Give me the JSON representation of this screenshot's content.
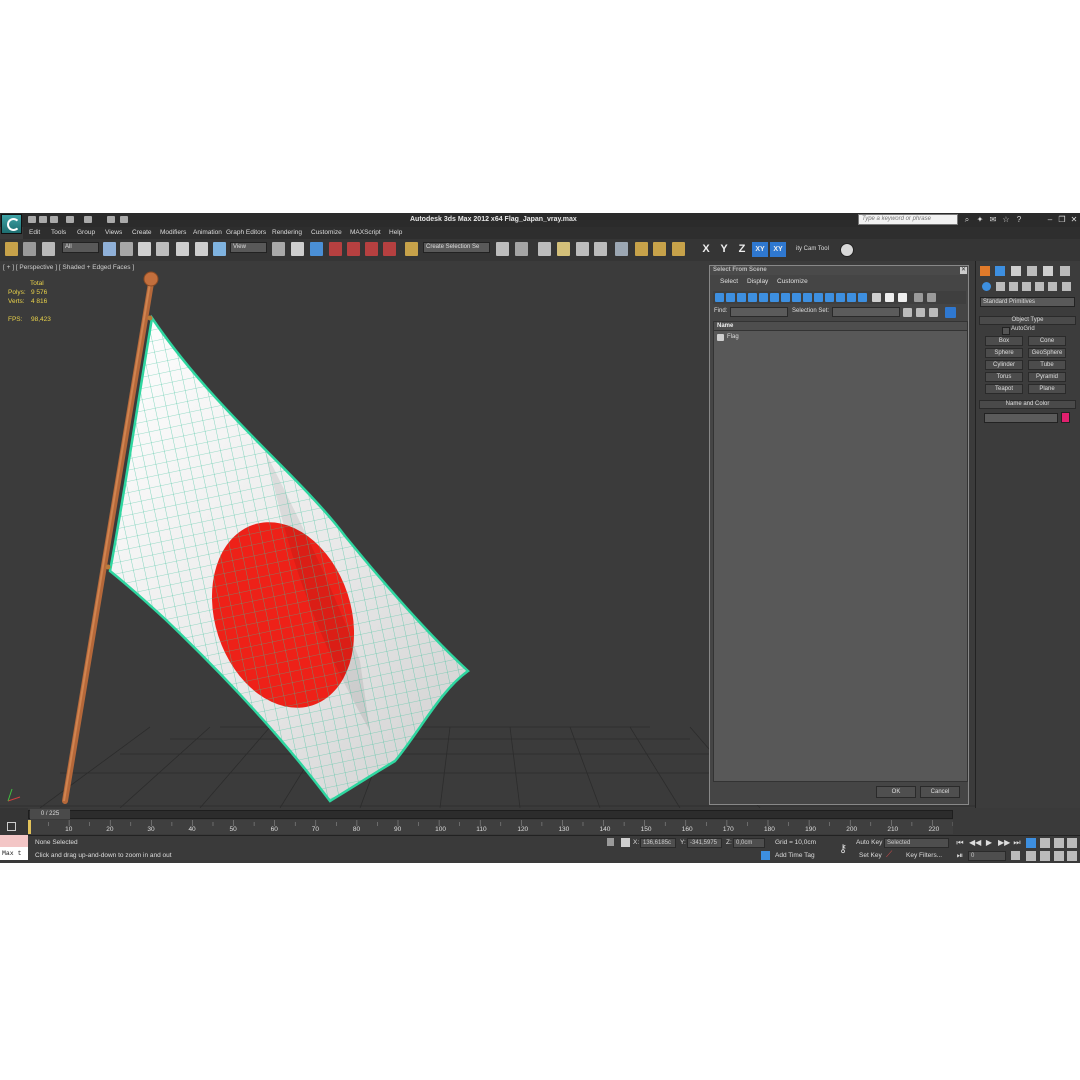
{
  "app": {
    "title": "Autodesk 3ds Max  2012 x64     Flag_Japan_vray.max",
    "search_placeholder": "Type a keyword or phrase"
  },
  "menu": [
    "Edit",
    "Tools",
    "Group",
    "Views",
    "Create",
    "Modifiers",
    "Animation",
    "Graph Editors",
    "Rendering",
    "Customize",
    "MAXScript",
    "Help"
  ],
  "toolbar": {
    "selection_filter": "All",
    "reference_coord": "View",
    "named_selection": "Create Selection Se",
    "axes": [
      "X",
      "Y",
      "Z",
      "XY",
      "XY"
    ],
    "cam_tool": "ity Cam Tool"
  },
  "viewport": {
    "label": "[ + ] [ Perspective ] [ Shaded + Edged Faces ]",
    "stats": {
      "total_label": "Total",
      "polys_label": "Polys:",
      "polys": "9 576",
      "verts_label": "Verts:",
      "verts": "4 816",
      "fps_label": "FPS:",
      "fps": "98,423"
    }
  },
  "dialog": {
    "title": "Select From Scene",
    "menu": [
      "Select",
      "Display",
      "Customize"
    ],
    "find_label": "Find:",
    "selection_set_label": "Selection Set:",
    "column_name": "Name",
    "items": [
      "Flag"
    ],
    "ok": "OK",
    "cancel": "Cancel"
  },
  "command_panel": {
    "dropdown": "Standard Primitives",
    "object_type_title": "Object Type",
    "autogrid": "AutoGrid",
    "primitives": [
      "Box",
      "Cone",
      "Sphere",
      "GeoSphere",
      "Cylinder",
      "Tube",
      "Torus",
      "Pyramid",
      "Teapot",
      "Plane"
    ],
    "name_color_title": "Name and Color",
    "object_color": "#e0206e"
  },
  "timeline": {
    "frame": "0 / 225",
    "ticks": [
      "10",
      "20",
      "30",
      "40",
      "50",
      "60",
      "70",
      "80",
      "90",
      "100",
      "110",
      "120",
      "130",
      "140",
      "150",
      "160",
      "170",
      "180",
      "190",
      "200",
      "210",
      "220"
    ]
  },
  "status": {
    "maxscript": "Max t",
    "selection": "None Selected",
    "prompt": "Click and drag up-and-down to zoom in and out",
    "x_label": "X:",
    "x": "136,6185c",
    "y_label": "Y:",
    "y": "-341,5975",
    "z_label": "Z:",
    "z": "0,0cm",
    "grid": "Grid = 10,0cm",
    "add_time_tag": "Add Time Tag",
    "auto_key": "Auto Key",
    "set_key": "Set Key",
    "key_mode": "Selected",
    "key_filters": "Key Filters...",
    "current_frame": "0"
  }
}
